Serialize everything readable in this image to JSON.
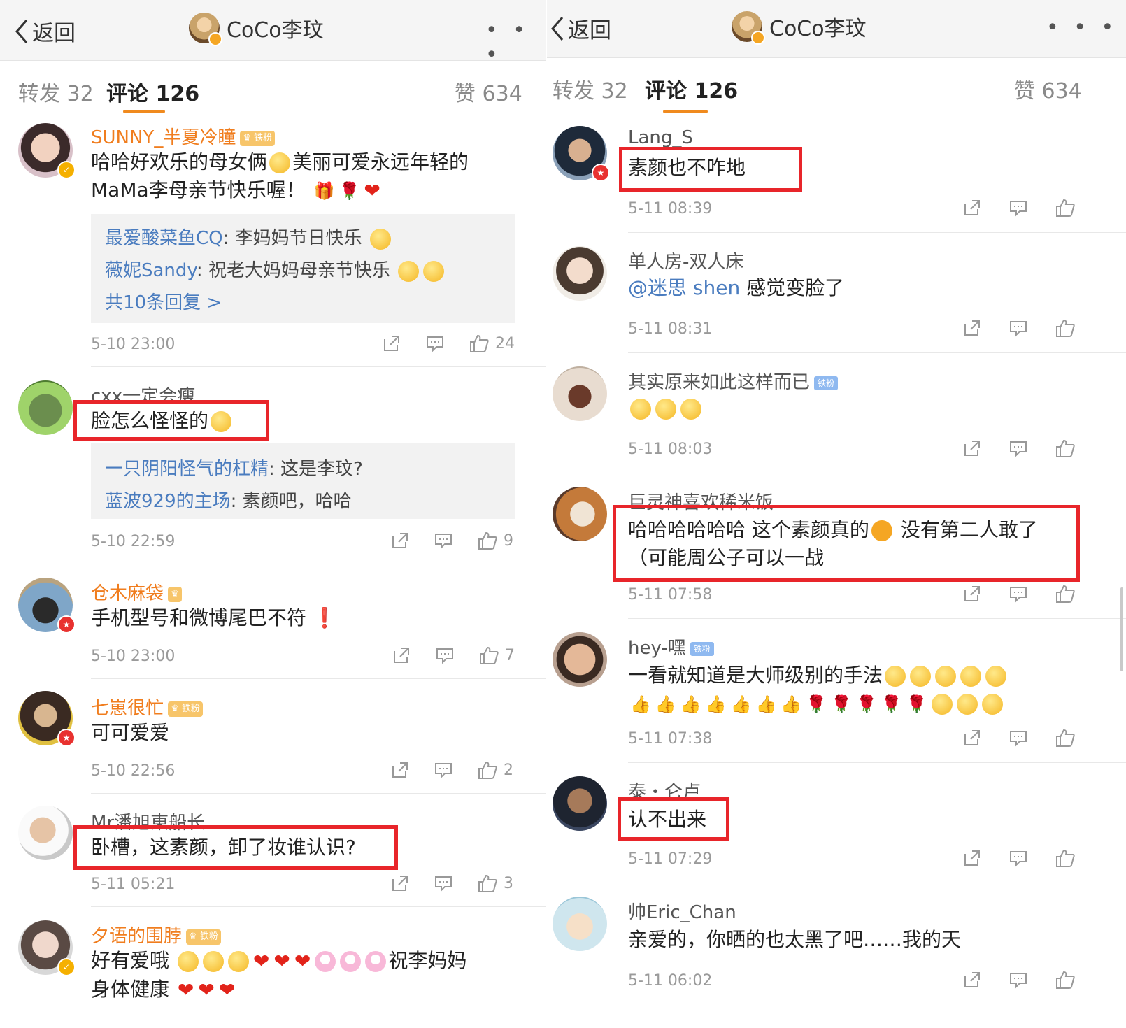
{
  "left": {
    "back_label": "返回",
    "page_title": "CoCo李玟",
    "more": "• • •",
    "tabs": {
      "repost": "转发 32",
      "comments": "评论 126",
      "likes": "赞 634"
    },
    "comments": [
      {
        "user": "SUNNY_半夏冷瞳",
        "badge": "铁粉",
        "text_line1": "哈哈好欢乐的母女俩",
        "text_line1b": "美丽可爱永远年轻的",
        "text_line2": "MaMa李母亲节快乐喔！",
        "replies": [
          {
            "name": "最爱酸菜鱼CQ",
            "text": ": 李妈妈节日快乐"
          },
          {
            "name": "薇妮Sandy",
            "text": ": 祝老大妈妈母亲节快乐"
          }
        ],
        "more_replies": "共10条回复 >",
        "time": "5-10 23:00",
        "likes": "24"
      },
      {
        "user": "cxx一定会瘦",
        "text": "脸怎么怪怪的",
        "replies": [
          {
            "name": "一只阴阳怪气的杠精",
            "text": ": 这是李玟?"
          },
          {
            "name": "蓝波929的主场",
            "text": ": 素颜吧，哈哈"
          }
        ],
        "time": "5-10 22:59",
        "likes": "9"
      },
      {
        "user": "仓木麻袋",
        "text": "手机型号和微博尾巴不符",
        "time": "5-10 23:00",
        "likes": "7"
      },
      {
        "user": "七崽很忙",
        "badge": "铁粉",
        "text": "可可爱爱",
        "time": "5-10 22:56",
        "likes": "2"
      },
      {
        "user": "Mr潘旭東船长",
        "text": "卧槽，这素颜，卸了妆谁认识?",
        "time": "5-11 05:21",
        "likes": "3"
      },
      {
        "user": "夕语的围脖",
        "badge": "铁粉",
        "text_line1": "好有爱哦",
        "text_line1b": "祝李妈妈",
        "text_line2": "身体健康"
      }
    ]
  },
  "right": {
    "back_label": "返回",
    "page_title": "CoCo李玟",
    "more": "• • •",
    "tabs": {
      "repost": "转发 32",
      "comments": "评论 126",
      "likes": "赞 634"
    },
    "comments": [
      {
        "user": "Lang_S",
        "text": "素颜也不咋地",
        "time": "5-11 08:39"
      },
      {
        "user": "单人房-双人床",
        "mention": "@迷思 shen",
        "text": " 感觉变脸了",
        "time": "5-11 08:31"
      },
      {
        "user": "其实原来如此这样而已",
        "badge": "铁粉",
        "text": "",
        "time": "5-11 08:03"
      },
      {
        "user": "巨灵神喜欢稀米饭",
        "text_line1a": "哈哈哈哈哈哈 这个素颜真的",
        "text_line1b": "没有第二人敢了",
        "text_line2": "（可能周公子可以一战",
        "time": "5-11 07:58"
      },
      {
        "user": "hey-嘿",
        "badge": "铁粉",
        "text": "一看就知道是大师级别的手法",
        "time": "5-11 07:38"
      },
      {
        "user": "泰・仑卢",
        "text": "认不出来",
        "time": "5-11 07:29"
      },
      {
        "user": "帅Eric_Chan",
        "text": "亲爱的，你晒的也太黑了吧……我的天",
        "time": "5-11 06:02"
      }
    ]
  },
  "colors": {
    "accent": "#f08a1e",
    "link": "#4a7cbf",
    "highlight_box": "#e8252a"
  }
}
